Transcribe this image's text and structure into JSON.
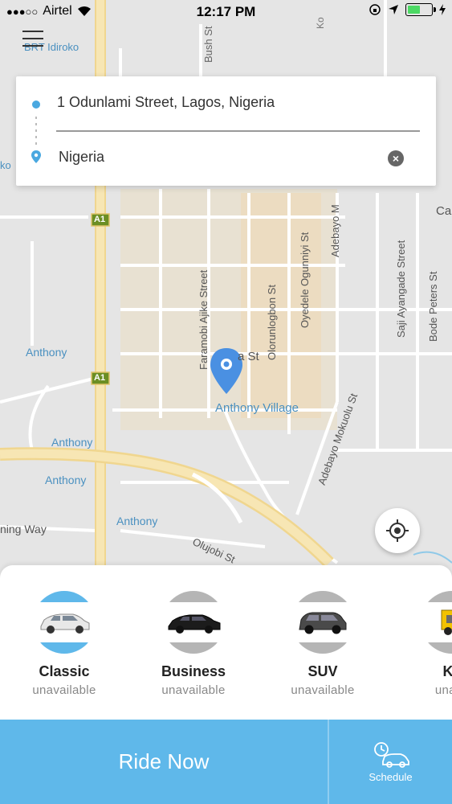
{
  "status_bar": {
    "carrier": "Airtel",
    "time": "12:17 PM",
    "battery_level": 0.55
  },
  "map": {
    "labels": {
      "brt_idiroko": "BRT Idiroko",
      "bush_st": "Bush St",
      "ko": "Ko",
      "ko_left": "ko",
      "ca": "Ca",
      "a1_top": "A1",
      "a1_mid": "A1",
      "faramobi": "Faramobi Ajike Street",
      "olorunlogbon": "Olorunlogbon St",
      "oyedele": "Oyedele Ogunniyi St",
      "adebayo_m": "Adebayo M",
      "saji": "Saji Ayangade Street",
      "bode": "Bode Peters St",
      "a_st": "a St",
      "anthony_1": "Anthony",
      "anthony_village": "Anthony Village",
      "anthony_2": "Anthony",
      "anthony_3": "Anthony",
      "anthony_4": "Anthony",
      "adebayo_mokuolu": "Adebayo Mokuolu St",
      "ning_way": "ning Way",
      "olujobi": "Olujobi St",
      "t_right": "t"
    }
  },
  "address": {
    "from": "1 Odunlami Street, Lagos, Nigeria",
    "to": "Nigeria",
    "clear_symbol": "×"
  },
  "vehicles": [
    {
      "name": "Classic",
      "status": "unavailable",
      "accent": "#5fb8ea"
    },
    {
      "name": "Business",
      "status": "unavailable",
      "accent": "#b5b5b5"
    },
    {
      "name": "SUV",
      "status": "unavailable",
      "accent": "#b5b5b5"
    },
    {
      "name": "Ke",
      "status": "unava",
      "accent": "#b5b5b5"
    }
  ],
  "actions": {
    "ride_now": "Ride Now",
    "schedule": "Schedule"
  },
  "colors": {
    "primary": "#5fb8ea",
    "pin": "#4a90e2",
    "highway": "#f2dda0"
  }
}
